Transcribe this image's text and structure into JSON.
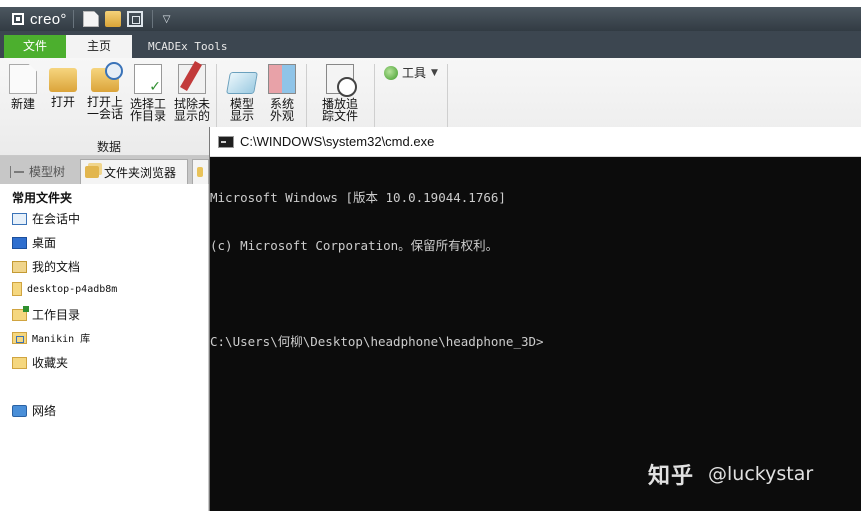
{
  "titlebar": {
    "logo_text": "creo",
    "logo_mark": "°",
    "quick_access": [
      "new-doc-icon",
      "open-folder-icon",
      "window-icon",
      "dropdown-icon"
    ]
  },
  "tabs": [
    {
      "label": "文件",
      "active": false
    },
    {
      "label": "主页",
      "active": true
    },
    {
      "label": "MCADEx Tools",
      "active": false
    }
  ],
  "ribbon": {
    "buttons": [
      {
        "label": "新建",
        "icon": "new-icon"
      },
      {
        "label": "打开",
        "icon": "open-icon"
      },
      {
        "label": "打开上\n一会话",
        "icon": "open-session-icon"
      },
      {
        "label": "选择工\n作目录",
        "icon": "select-workdir-icon"
      },
      {
        "label": "拭除未\n显示的",
        "icon": "erase-icon"
      },
      {
        "label": "模型\n显示",
        "icon": "model-display-icon"
      },
      {
        "label": "系统\n外观",
        "icon": "system-appearance-icon"
      },
      {
        "label": "播放追\n踪文件",
        "icon": "play-trail-icon"
      }
    ],
    "group_label": "数据",
    "tools_label": "工具"
  },
  "panel": {
    "tabs": [
      {
        "label": "模型树"
      },
      {
        "label": "文件夹浏览器"
      },
      {
        "label": ""
      }
    ],
    "section_title": "常用文件夹",
    "items": [
      {
        "label": "在会话中",
        "icon": "session-icon"
      },
      {
        "label": "桌面",
        "icon": "desktop-icon"
      },
      {
        "label": "我的文档",
        "icon": "documents-icon"
      },
      {
        "label": "desktop-p4adb8m",
        "icon": "folder-icon"
      },
      {
        "label": "工作目录",
        "icon": "workdir-icon"
      },
      {
        "label": "Manikin 库",
        "icon": "library-icon"
      },
      {
        "label": "收藏夹",
        "icon": "favorites-icon"
      },
      {
        "label": "网络",
        "icon": "network-icon"
      }
    ]
  },
  "cmd": {
    "title": "C:\\WINDOWS\\system32\\cmd.exe",
    "lines": [
      "Microsoft Windows [版本 10.0.19044.1766]",
      "(c) Microsoft Corporation。保留所有权利。",
      "",
      "C:\\Users\\何柳\\Desktop\\headphone\\headphone_3D>"
    ]
  },
  "watermark": {
    "site": "知乎",
    "user": "@luckystar"
  }
}
